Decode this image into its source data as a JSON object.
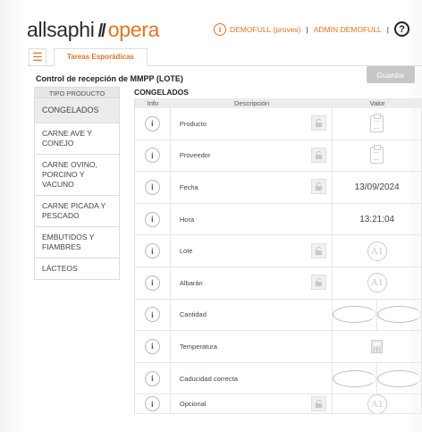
{
  "header": {
    "logo_part1": "allsaphi",
    "logo_slash": "//",
    "logo_part2": "opera",
    "user_company": "DEMOFULL (proves)",
    "user_separator": "|",
    "user_name": "ADMIN DEMOFULL",
    "info_glyph": "i",
    "help_glyph": "?"
  },
  "tabs": {
    "menu_glyph": "☰",
    "items": [
      {
        "label": "Tareas Esporádicas"
      }
    ]
  },
  "page": {
    "title": "Control de recepción de MMPP (LOTE)",
    "save_label": "Guardar"
  },
  "types": {
    "header": "TIPO PRODUCTO",
    "items": [
      {
        "label": "CONGELADOS",
        "active": true
      },
      {
        "label": "CARNE AVE Y CONEJO"
      },
      {
        "label": "CARNE OVINO, PORCINO Y VACUNO"
      },
      {
        "label": "CARNE PICADA Y PESCADO"
      },
      {
        "label": "EMBUTIDOS Y FIAMBRES"
      },
      {
        "label": "LÁCTEOS"
      }
    ]
  },
  "section": {
    "title": "CONGELADOS"
  },
  "table": {
    "columns": [
      "Info",
      "Descripción",
      "Valor"
    ],
    "rows": [
      {
        "description": "Producto",
        "locked": true,
        "value_type": "clipboard-icon"
      },
      {
        "description": "Proveedor",
        "locked": true,
        "value_type": "clipboard-icon"
      },
      {
        "description": "Fecha",
        "locked": true,
        "value_type": "text",
        "value": "13/09/2024"
      },
      {
        "description": "Hora",
        "locked": false,
        "value_type": "text",
        "value": "13:21:04"
      },
      {
        "description": "Lote",
        "locked": true,
        "value_type": "ai-icon"
      },
      {
        "description": "Albarán",
        "locked": true,
        "value_type": "ai-icon"
      },
      {
        "description": "Cantidad",
        "locked": false,
        "value_type": "radio-pair"
      },
      {
        "description": "Temperatura",
        "locked": false,
        "value_type": "calculator-icon"
      },
      {
        "description": "Caducidad correcta",
        "locked": false,
        "value_type": "radio-pair"
      },
      {
        "description": "Opcional",
        "locked": true,
        "value_type": "ai-icon"
      }
    ],
    "info_glyph": "i",
    "ai_glyph": "A1"
  },
  "colors": {
    "brand_orange": "#e8731f",
    "info_blue": "#2c5f9b",
    "save_disabled": "#c7c7c7"
  }
}
